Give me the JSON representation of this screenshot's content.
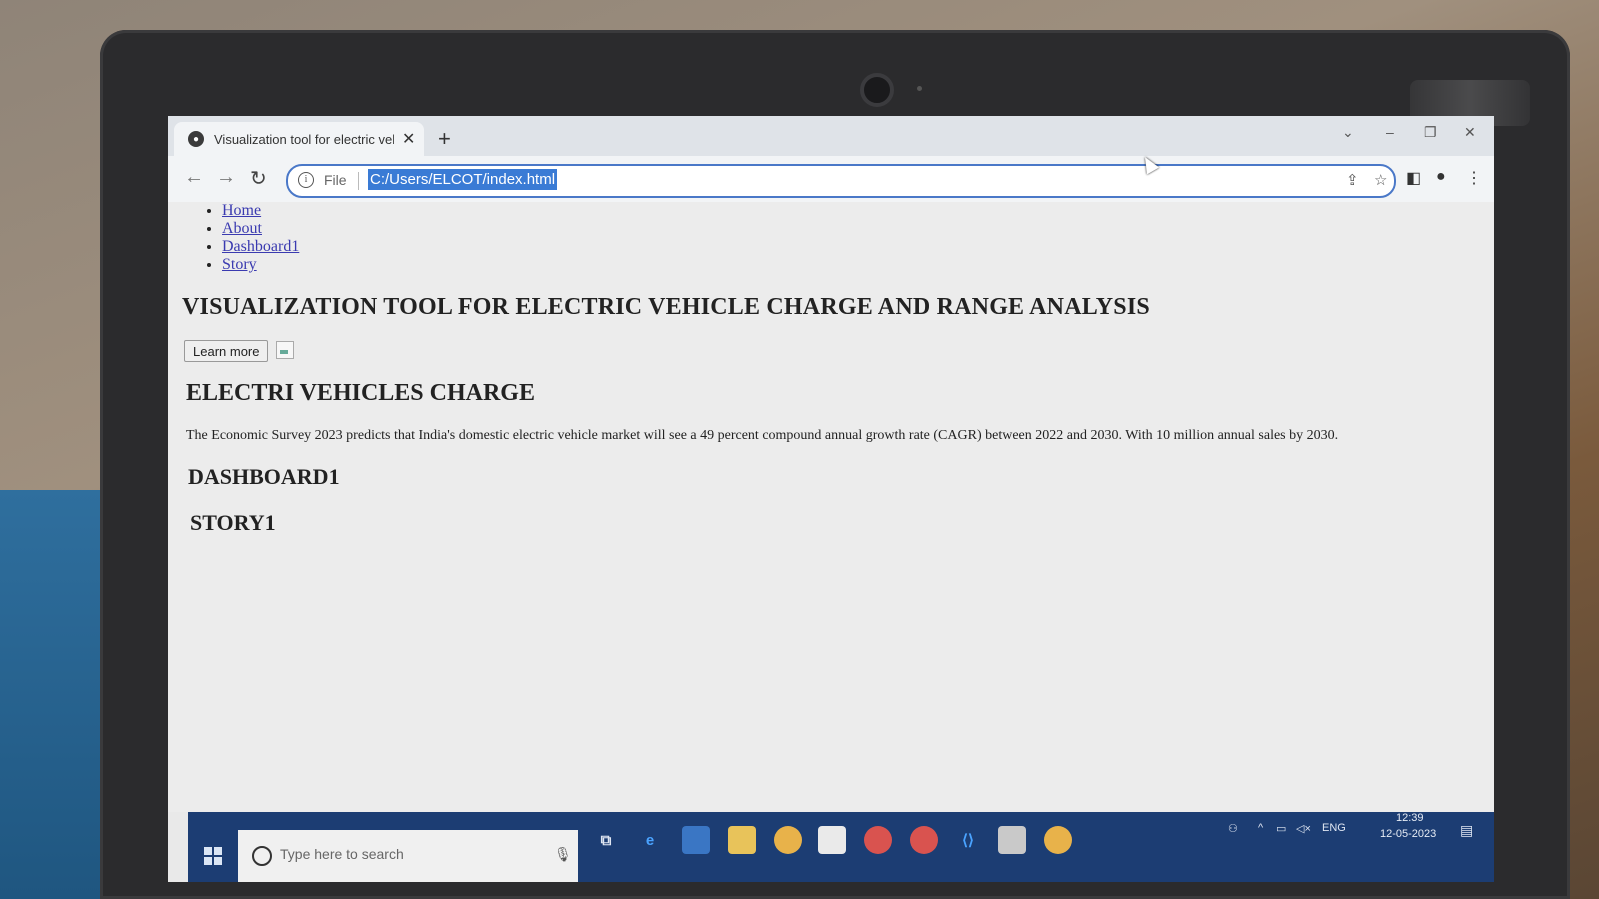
{
  "browser": {
    "tab_title": "Visualization tool for electric veh",
    "address_scheme": "File",
    "address_url": "C:/Users/ELCOT/index.html"
  },
  "page": {
    "nav_links": [
      "Home",
      "About",
      "Dashboard1",
      "Story"
    ],
    "main_title": "VISUALIZATION TOOL FOR ELECTRIC VEHICLE CHARGE AND RANGE ANALYSIS",
    "learn_more_label": "Learn more",
    "section_charge_title": "ELECTRI VEHICLES CHARGE",
    "section_charge_text": "The Economic Survey 2023 predicts that India's domestic electric vehicle market will see a 49 percent compound annual growth rate (CAGR) between 2022 and 2030. With 10 million annual sales by 2030.",
    "section_dashboard_title": "DASHBOARD1",
    "section_story_title": "STORY1"
  },
  "taskbar": {
    "search_placeholder": "Type here to search",
    "language": "ENG",
    "time": "12:39",
    "date": "12-05-2023"
  },
  "colors": {
    "taskbar_bg": "#1c3d73",
    "link": "#3a3ab0",
    "url_highlight": "#3a7bd5"
  }
}
